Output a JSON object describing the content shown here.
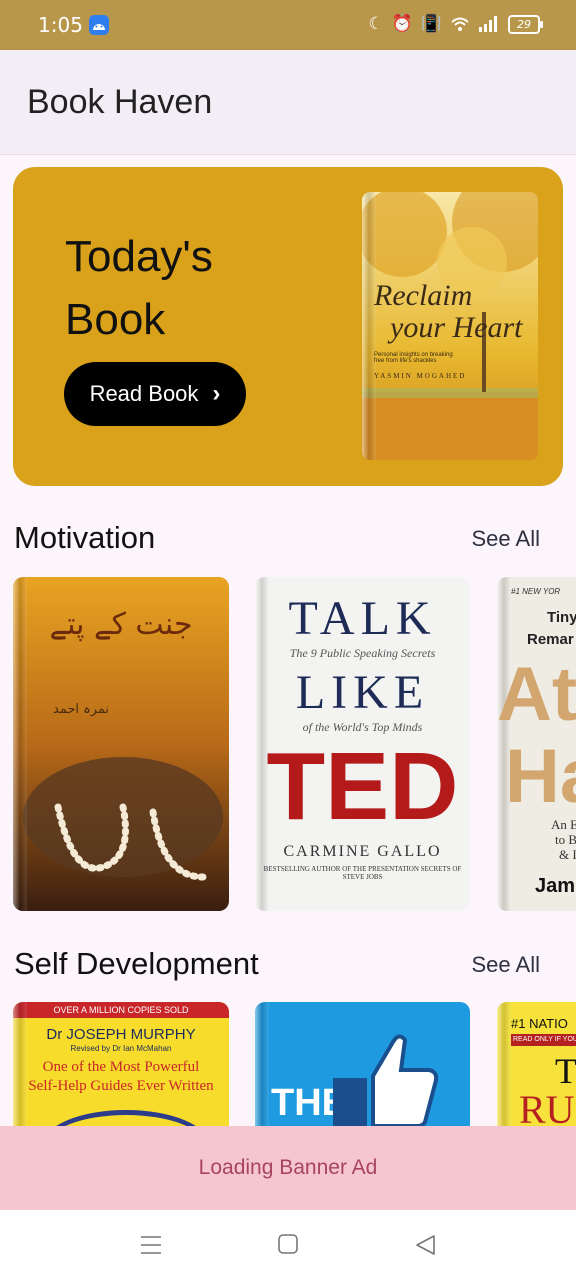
{
  "status": {
    "time": "1:05",
    "battery": "29"
  },
  "app": {
    "title": "Book Haven"
  },
  "hero": {
    "title": "Today's Book",
    "button": "Read Book",
    "book": {
      "title_line1": "Reclaim",
      "title_line2": "your Heart",
      "subtitle": "Personal insights on breaking free from life's shackles",
      "author": "YASMIN MOGAHED"
    }
  },
  "sections": [
    {
      "title": "Motivation",
      "see_all": "See All",
      "books": [
        {
          "title": "جنت کے پتے",
          "author": "نمرہ احمد"
        },
        {
          "line1": "TALK",
          "sub1": "The 9 Public Speaking Secrets",
          "line2": "LIKE",
          "sub2": "of the World's Top Minds",
          "line3": "TED",
          "author": "CARMINE GALLO",
          "tagline": "BESTSELLING AUTHOR OF THE PRESENTATION SECRETS OF STEVE JOBS"
        },
        {
          "top": "#1 NEW YOR",
          "l1": "Tiny",
          "l2": "Remar",
          "big1": "Ato",
          "big2": "Ha",
          "s1": "An E",
          "s2": "to B",
          "s3": "& I",
          "author": "Jam"
        }
      ]
    },
    {
      "title": "Self Development",
      "see_all": "See All",
      "books": [
        {
          "banner": "OVER A MILLION COPIES SOLD",
          "author": "Dr JOSEPH MURPHY",
          "revised": "Revised by Dr Ian McMahan",
          "t1": "One of the Most Powerful",
          "t2": "Self-Help Guides Ever Written"
        },
        {
          "title": "THE"
        },
        {
          "top": "#1 NATIO",
          "read": "READ ONLY IF YOU'RE",
          "t": "T",
          "ru": "RU"
        }
      ]
    }
  ],
  "ad": {
    "text": "Loading Banner Ad"
  },
  "colors": {
    "status_bar": "#b8964a",
    "hero_bg": "#d9a21a",
    "ad_bg": "#f5c5d0",
    "ad_text": "#a8455d"
  }
}
